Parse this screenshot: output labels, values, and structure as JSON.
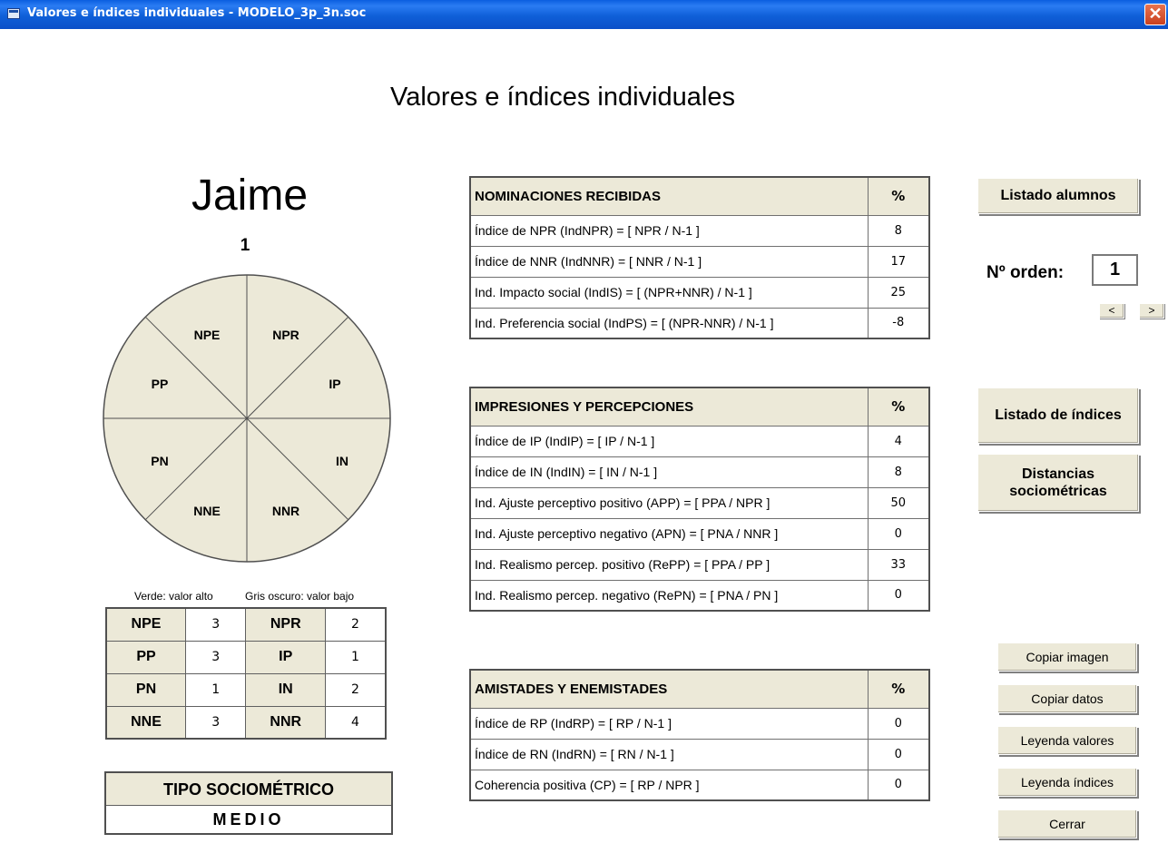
{
  "window": {
    "title": "Valores e índices individuales - MODELO_3p_3n.soc",
    "close_glyph": "✕"
  },
  "page_title": "Valores e índices individuales",
  "student": {
    "name": "Jaime",
    "number": "1"
  },
  "wheel": {
    "labels": {
      "npe": "NPE",
      "npr": "NPR",
      "pp": "PP",
      "ip": "IP",
      "pn": "PN",
      "in": "IN",
      "nne": "NNE",
      "nnr": "NNR"
    },
    "fill_color": "#ece9d8"
  },
  "legend": {
    "high": "Verde: valor alto",
    "low": "Gris oscuro: valor bajo"
  },
  "values_table": [
    {
      "label_a": "NPE",
      "value_a": "3",
      "label_b": "NPR",
      "value_b": "2"
    },
    {
      "label_a": "PP",
      "value_a": "3",
      "label_b": "IP",
      "value_b": "1"
    },
    {
      "label_a": "PN",
      "value_a": "1",
      "label_b": "IN",
      "value_b": "2"
    },
    {
      "label_a": "NNE",
      "value_a": "3",
      "label_b": "NNR",
      "value_b": "4"
    }
  ],
  "tipo": {
    "label": "TIPO SOCIOMÉTRICO",
    "value": "MEDIO"
  },
  "tables": {
    "nominaciones": {
      "title": "NOMINACIONES RECIBIDAS",
      "pct": "%",
      "rows": [
        {
          "label": "Índice de NPR (IndNPR) = [ NPR / N-1 ]",
          "value": "8"
        },
        {
          "label": "Índice de NNR (IndNNR) = [ NNR / N-1 ]",
          "value": "17"
        },
        {
          "label": "Ind. Impacto social (IndIS) = [ (NPR+NNR) / N-1 ]",
          "value": "25"
        },
        {
          "label": "Ind. Preferencia social (IndPS) = [ (NPR-NNR) / N-1 ]",
          "value": "-8"
        }
      ]
    },
    "impresiones": {
      "title": "IMPRESIONES Y PERCEPCIONES",
      "pct": "%",
      "rows": [
        {
          "label": "Índice de IP (IndIP) = [ IP / N-1 ]",
          "value": "4"
        },
        {
          "label": "Índice de IN (IndIN) = [ IN / N-1 ]",
          "value": "8"
        },
        {
          "label": "Ind. Ajuste perceptivo positivo (APP) = [ PPA / NPR ]",
          "value": "50"
        },
        {
          "label": "Ind. Ajuste perceptivo negativo (APN) = [ PNA / NNR ]",
          "value": "0"
        },
        {
          "label": "Ind. Realismo percep. positivo (RePP) = [ PPA / PP ]",
          "value": "33"
        },
        {
          "label": "Ind. Realismo percep. negativo (RePN) = [ PNA / PN ]",
          "value": "0"
        }
      ]
    },
    "amistades": {
      "title": "AMISTADES Y ENEMISTADES",
      "pct": "%",
      "rows": [
        {
          "label": "Índice de RP (IndRP) = [ RP / N-1 ]",
          "value": "0"
        },
        {
          "label": "Índice de RN (IndRN) = [ RN / N-1 ]",
          "value": "0"
        },
        {
          "label": "Coherencia positiva (CP) = [ RP / NPR ]",
          "value": "0"
        }
      ]
    }
  },
  "buttons": {
    "listado_alumnos": "Listado alumnos",
    "listado_indices": "Listado de índices",
    "distancias_line1": "Distancias",
    "distancias_line2": "sociométricas",
    "copiar_imagen": "Copiar imagen",
    "copiar_datos": "Copiar datos",
    "leyenda_valores": "Leyenda valores",
    "leyenda_indices": "Leyenda índices",
    "cerrar": "Cerrar"
  },
  "orden": {
    "label": "Nº orden:",
    "value": "1",
    "prev": "<",
    "next": ">"
  }
}
